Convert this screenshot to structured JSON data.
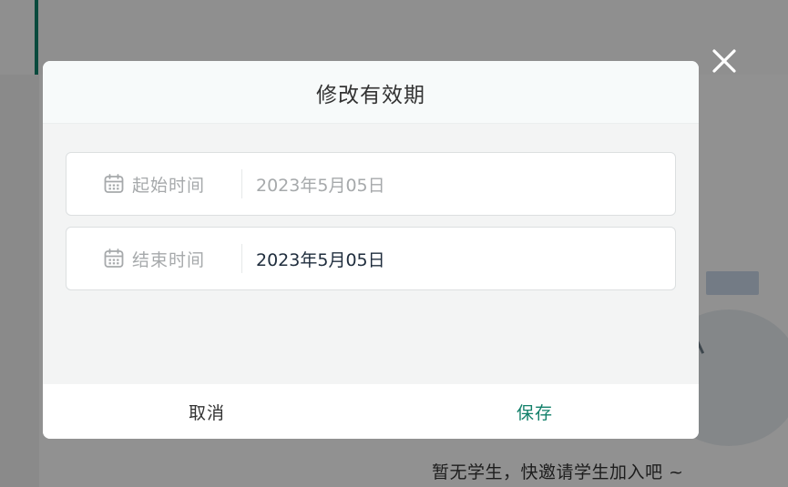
{
  "background": {
    "empty_state_text": "暂无学生，快邀请学生加入吧 ~"
  },
  "modal": {
    "title": "修改有效期",
    "start_field": {
      "icon": "calendar-icon",
      "label": "起始时间",
      "value": "2023年5月05日"
    },
    "end_field": {
      "icon": "calendar-icon",
      "label": "结束时间",
      "value": "2023年5月05日"
    },
    "cancel_label": "取消",
    "save_label": "保存",
    "close_icon": "close-icon"
  },
  "colors": {
    "accent": "#12806a",
    "overlay": "rgba(0,0,0,0.42)",
    "placeholder_text": "#a6a9ab",
    "value_text": "#1f2d3d"
  }
}
